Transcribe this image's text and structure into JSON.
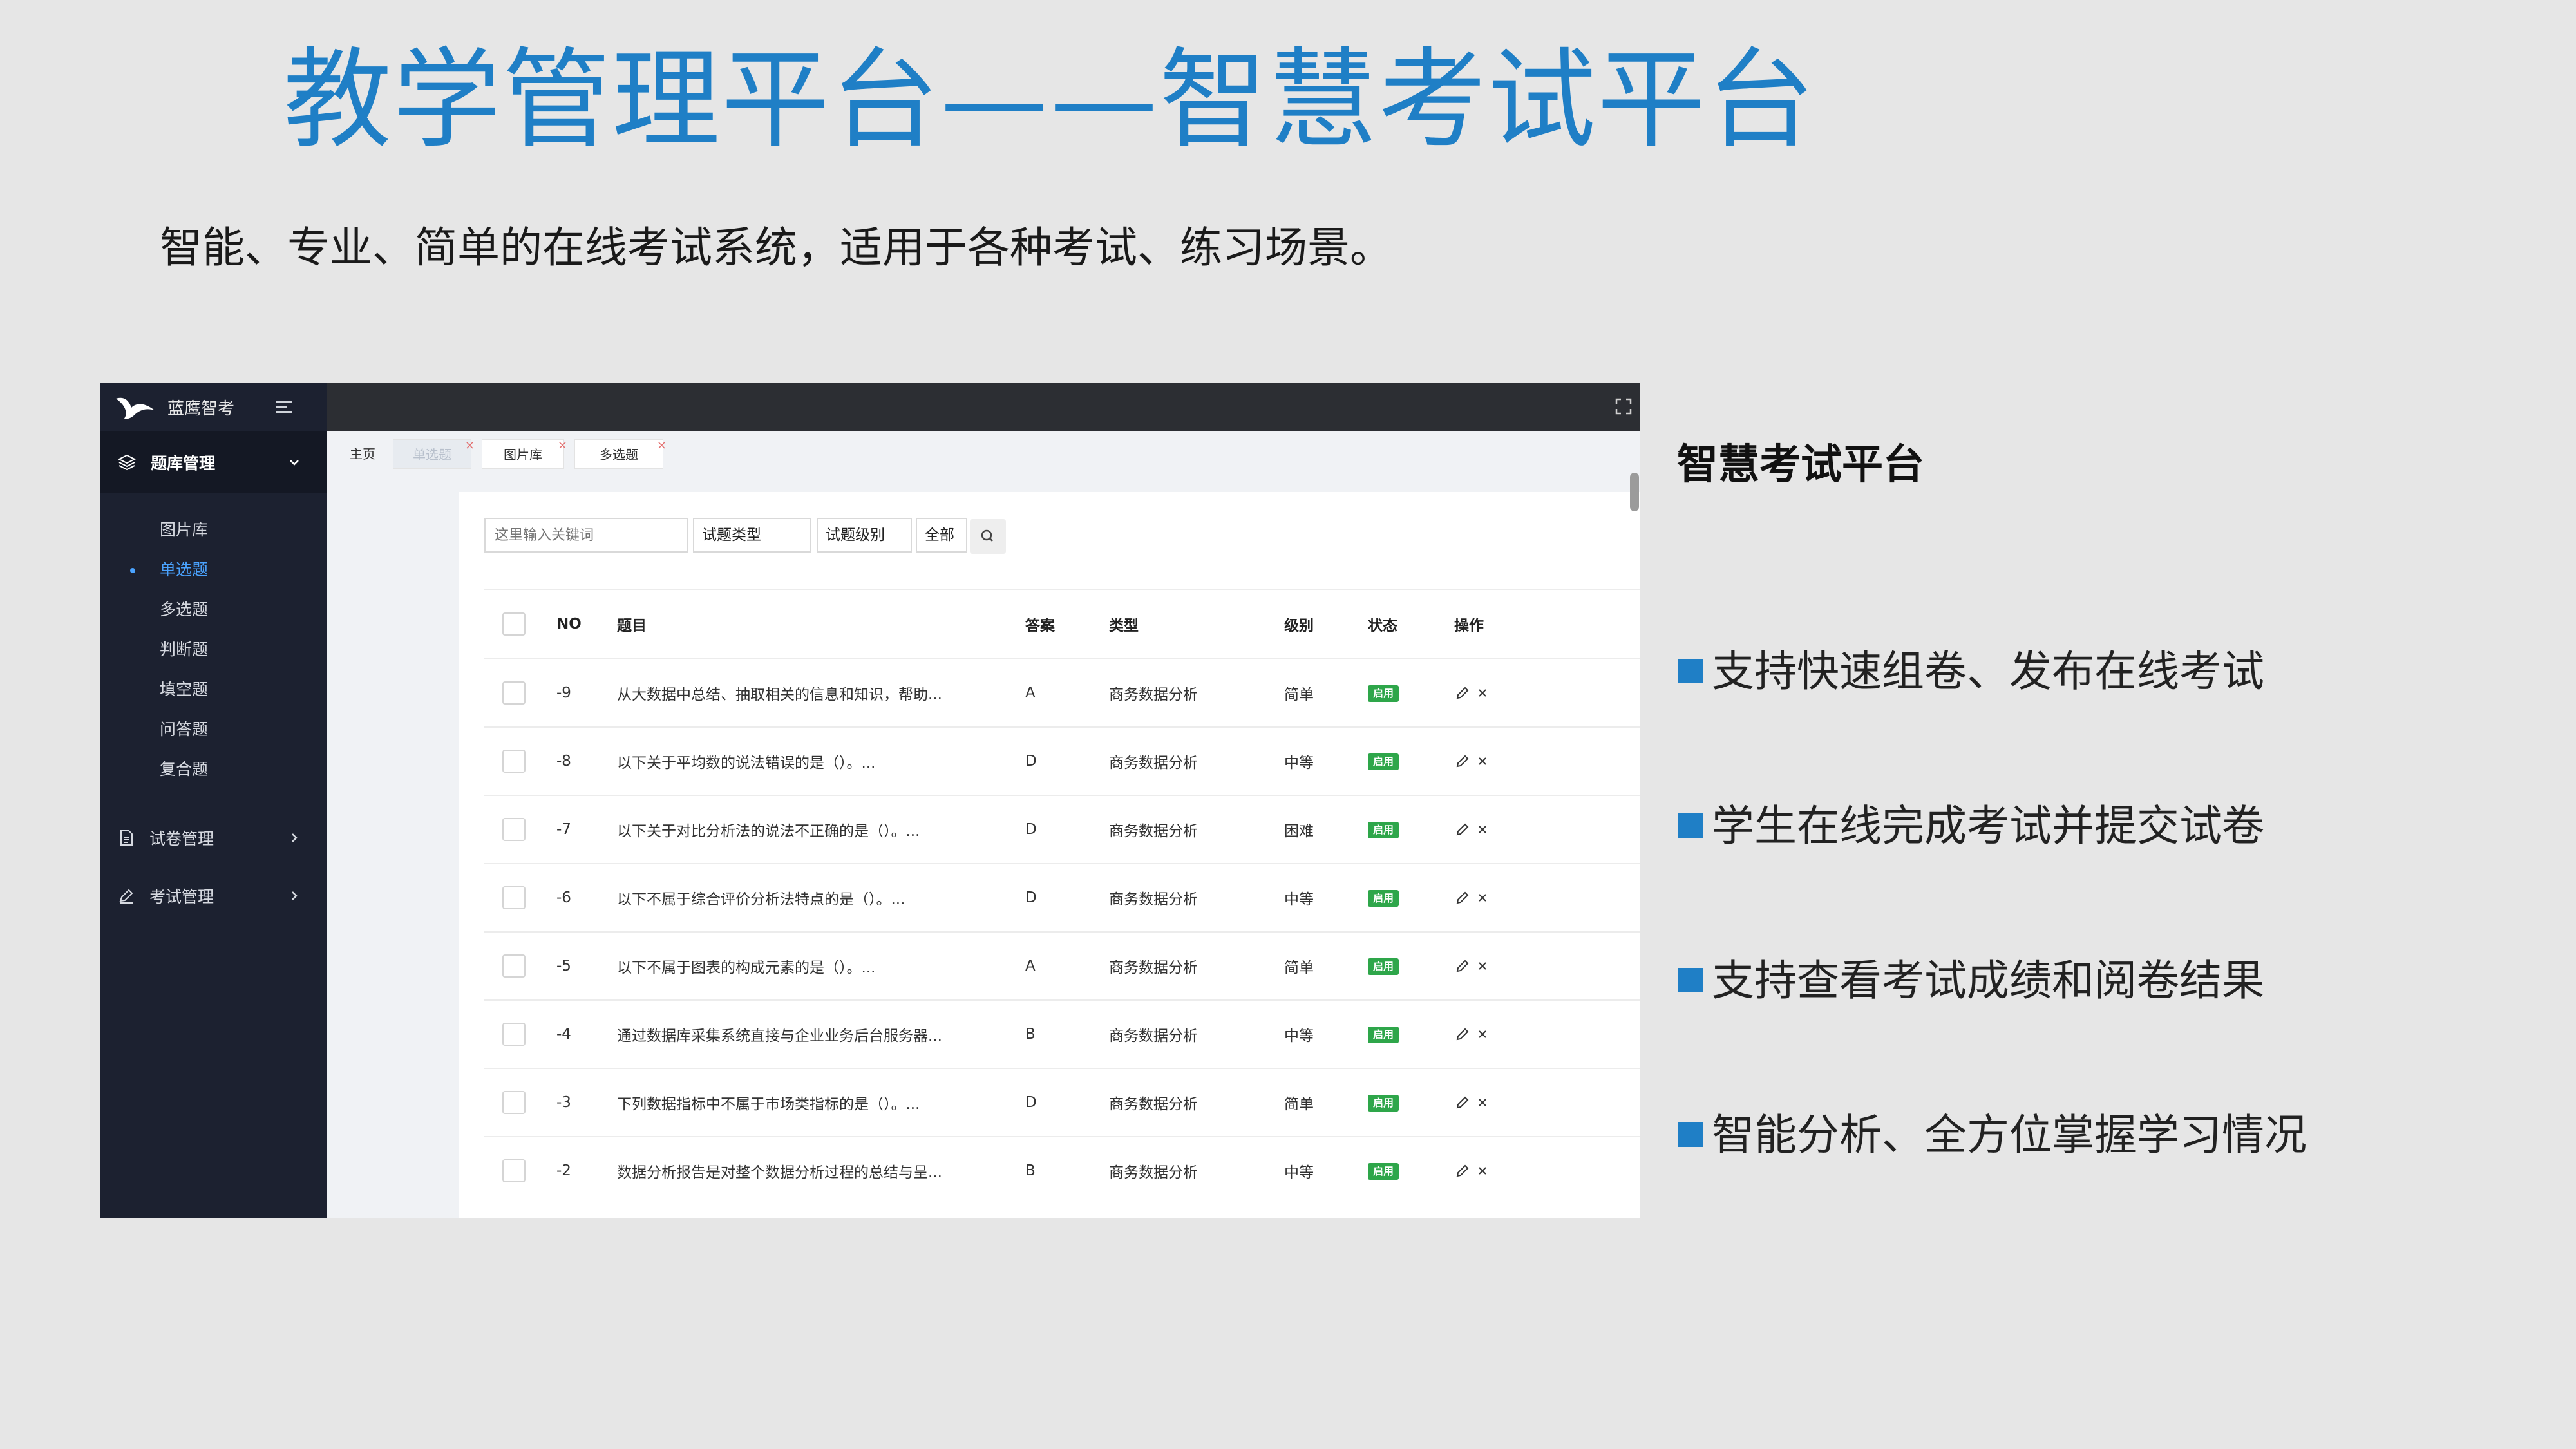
{
  "slide": {
    "title": "教学管理平台——智慧考试平台",
    "subtitle": "智能、专业、简单的在线考试系统，适用于各种考试、练习场景。",
    "side_title": "智慧考试平台",
    "bullets": [
      "支持快速组卷、发布在线考试",
      "学生在线完成考试并提交试卷",
      "支持查看考试成绩和阅卷结果",
      "智能分析、全方位掌握学习情况"
    ],
    "accent_color": "#1f7fc6"
  },
  "app": {
    "brand": "蓝鹰智考",
    "sidebar": {
      "group_label": "题库管理",
      "sub_items": [
        "图片库",
        "单选题",
        "多选题",
        "判断题",
        "填空题",
        "问答题",
        "复合题"
      ],
      "active_sub_item": "单选题",
      "menu_items": [
        "试卷管理",
        "考试管理"
      ]
    },
    "tabs": [
      "主页",
      "单选题",
      "图片库",
      "多选题"
    ],
    "active_tab": "单选题",
    "filters": {
      "search_placeholder": "这里输入关键词",
      "type_select": "试题类型",
      "level_select": "试题级别",
      "all_select": "全部"
    },
    "table": {
      "headers": [
        "NO",
        "题目",
        "答案",
        "类型",
        "级别",
        "状态",
        "操作"
      ],
      "rows": [
        {
          "no": "-9",
          "title": "从大数据中总结、抽取相关的信息和知识，帮助...",
          "answer": "A",
          "type": "商务数据分析",
          "level": "简单",
          "status": "启用"
        },
        {
          "no": "-8",
          "title": "以下关于平均数的说法错误的是（）。...",
          "answer": "D",
          "type": "商务数据分析",
          "level": "中等",
          "status": "启用"
        },
        {
          "no": "-7",
          "title": "以下关于对比分析法的说法不正确的是（）。...",
          "answer": "D",
          "type": "商务数据分析",
          "level": "困难",
          "status": "启用"
        },
        {
          "no": "-6",
          "title": "以下不属于综合评价分析法特点的是（）。...",
          "answer": "D",
          "type": "商务数据分析",
          "level": "中等",
          "status": "启用"
        },
        {
          "no": "-5",
          "title": "以下不属于图表的构成元素的是（）。...",
          "answer": "A",
          "type": "商务数据分析",
          "level": "简单",
          "status": "启用"
        },
        {
          "no": "-4",
          "title": "通过数据库采集系统直接与企业业务后台服务器...",
          "answer": "B",
          "type": "商务数据分析",
          "level": "中等",
          "status": "启用"
        },
        {
          "no": "-3",
          "title": "下列数据指标中不属于市场类指标的是（）。...",
          "answer": "D",
          "type": "商务数据分析",
          "level": "简单",
          "status": "启用"
        },
        {
          "no": "-2",
          "title": "数据分析报告是对整个数据分析过程的总结与呈...",
          "answer": "B",
          "type": "商务数据分析",
          "level": "中等",
          "status": "启用"
        }
      ]
    }
  }
}
